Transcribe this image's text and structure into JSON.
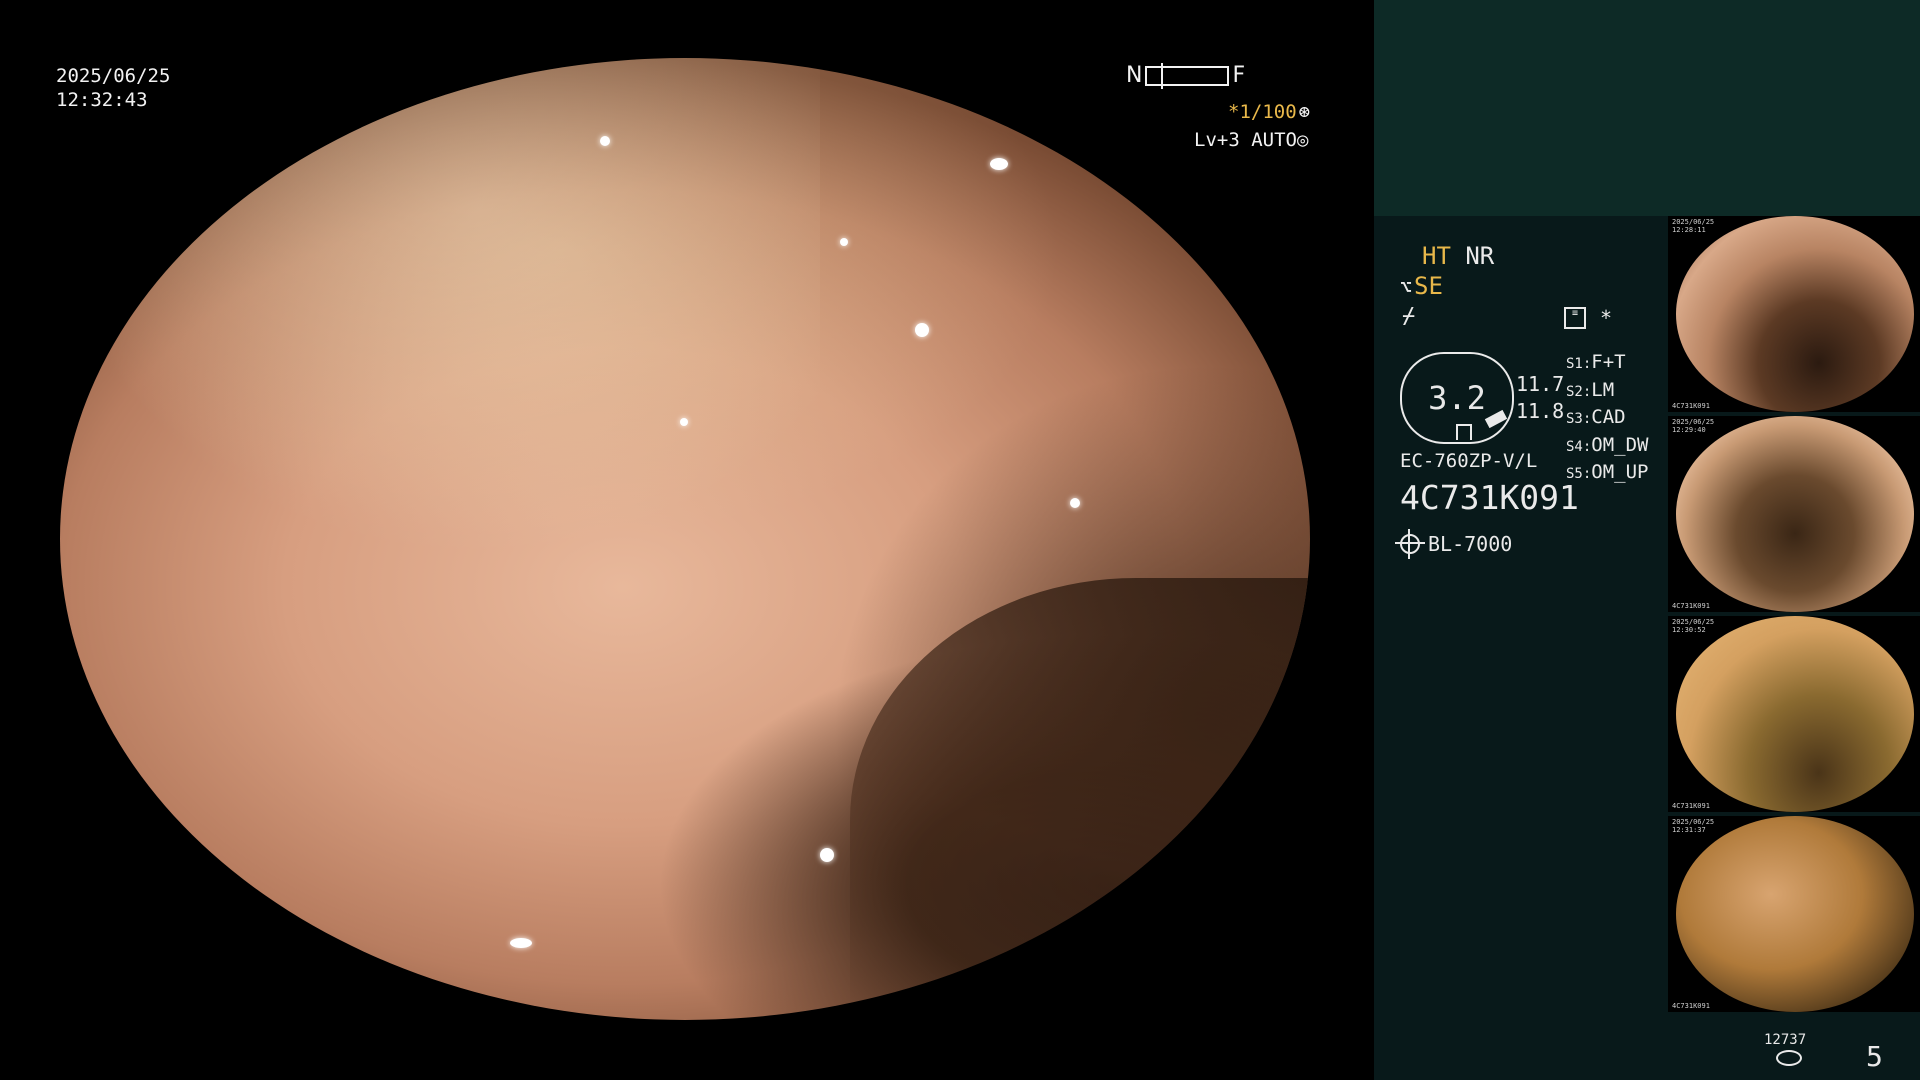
{
  "overlay": {
    "date": "2025/06/25",
    "time": "12:32:43",
    "near_label": "N",
    "far_label": "F",
    "shutter": "*1/100",
    "shutter_icon": "aperture-icon",
    "level": "Lv+3",
    "iris_mode": "AUTO",
    "iris_icon": "iris-icon"
  },
  "panel": {
    "ht": "HT",
    "nr": "NR",
    "se": "SE",
    "se_icon": "structure-enhance-icon",
    "freeze_icon": "freeze-icon",
    "record_icon": "record-icon",
    "star": "*",
    "zoom": "3.2",
    "value_1": "11.7",
    "value_2": "11.8",
    "presets": [
      {
        "key": "S1:",
        "value": "F+T"
      },
      {
        "key": "S2:",
        "value": "LM"
      },
      {
        "key": "S3:",
        "value": "CAD"
      },
      {
        "key": "S4:",
        "value": "OM_DW"
      },
      {
        "key": "S5:",
        "value": "OM_UP"
      }
    ],
    "model": "EC-760ZP-V/L",
    "serial": "4C731K091",
    "light_source": "BL-7000",
    "light_icon": "light-source-icon"
  },
  "thumbnails": [
    {
      "caption_top": "2025/06/25\n12:28:11",
      "caption_bottom": "4C731K091"
    },
    {
      "caption_top": "2025/06/25\n12:29:40",
      "caption_bottom": "4C731K091"
    },
    {
      "caption_top": "2025/06/25\n12:30:52",
      "caption_bottom": "4C731K091"
    },
    {
      "caption_top": "2025/06/25\n12:31:37",
      "caption_bottom": "4C731K091"
    }
  ],
  "footer": {
    "image_count": "12737",
    "storage_icon": "disk-icon",
    "page_number": "5"
  },
  "colors": {
    "accent_amber": "#e9b84a",
    "panel_top": "#0d2a26",
    "panel_main": "#08191a"
  }
}
